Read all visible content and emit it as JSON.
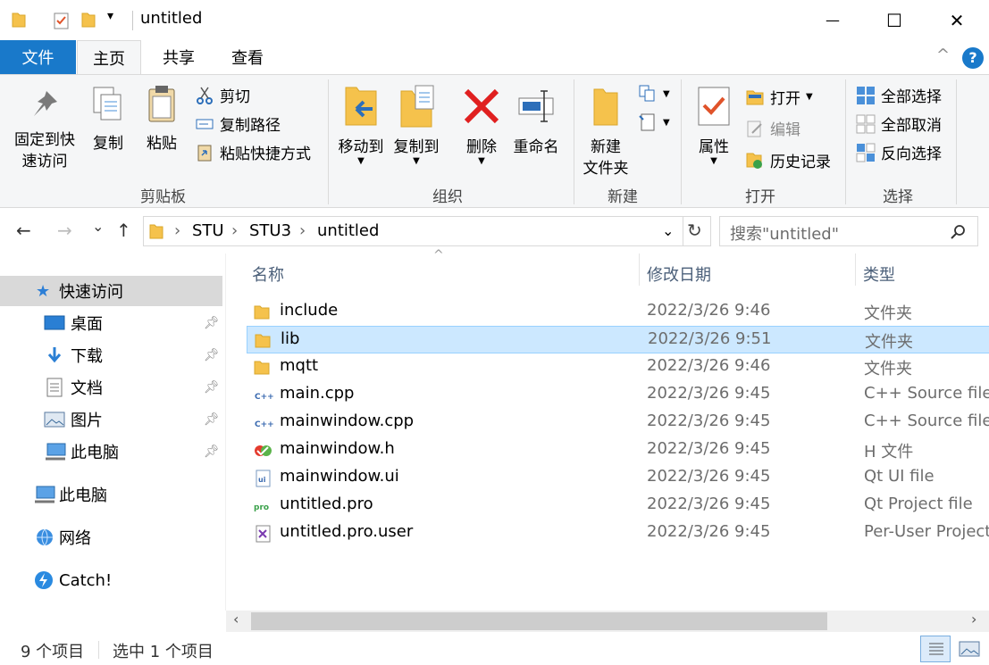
{
  "window": {
    "title": "untitled",
    "qa_dropdown": "▾",
    "minimize": "—",
    "maximize": "☐",
    "close": "✕"
  },
  "tabs": {
    "file": "文件",
    "home": "主页",
    "share": "共享",
    "view": "查看",
    "help": "?",
    "collapse": "^"
  },
  "ribbon": {
    "clipboard": {
      "label": "剪贴板",
      "pin_line1": "固定到快",
      "pin_line2": "速访问",
      "copy": "复制",
      "paste": "粘贴",
      "cut": "剪切",
      "copy_path": "复制路径",
      "paste_shortcut": "粘贴快捷方式"
    },
    "organize": {
      "label": "组织",
      "move_to": "移动到",
      "copy_to": "复制到",
      "delete": "删除",
      "rename": "重命名"
    },
    "new": {
      "label": "新建",
      "new_folder_line1": "新建",
      "new_folder_line2": "文件夹"
    },
    "open": {
      "label": "打开",
      "properties": "属性",
      "open": "打开",
      "edit": "编辑",
      "history": "历史记录"
    },
    "select": {
      "label": "选择",
      "select_all": "全部选择",
      "select_none": "全部取消",
      "invert": "反向选择"
    }
  },
  "nav": {
    "back": "←",
    "forward": "→",
    "recent": "⌄",
    "up": "↑",
    "breadcrumbs": [
      "STU",
      "STU3",
      "untitled"
    ],
    "sep": "›",
    "search_placeholder": "搜索\"untitled\""
  },
  "sidebar": {
    "quick_access": "快速访问",
    "items": [
      {
        "label": "桌面",
        "icon": "desktop-icon"
      },
      {
        "label": "下载",
        "icon": "download-icon"
      },
      {
        "label": "文档",
        "icon": "document-icon"
      },
      {
        "label": "图片",
        "icon": "picture-icon"
      },
      {
        "label": "此电脑",
        "icon": "computer-icon"
      }
    ],
    "this_pc": "此电脑",
    "network": "网络",
    "catch": "Catch!"
  },
  "columns": {
    "name": "名称",
    "date": "修改日期",
    "type": "类型"
  },
  "files": [
    {
      "name": "include",
      "date": "2022/3/26 9:46",
      "type": "文件夹",
      "icon": "folder-icon"
    },
    {
      "name": "lib",
      "date": "2022/3/26 9:51",
      "type": "文件夹",
      "icon": "folder-icon",
      "selected": true
    },
    {
      "name": "mqtt",
      "date": "2022/3/26 9:46",
      "type": "文件夹",
      "icon": "folder-icon"
    },
    {
      "name": "main.cpp",
      "date": "2022/3/26 9:45",
      "type": "C++ Source file",
      "icon": "cpp-file-icon"
    },
    {
      "name": "mainwindow.cpp",
      "date": "2022/3/26 9:45",
      "type": "C++ Source file",
      "icon": "cpp-file-icon"
    },
    {
      "name": "mainwindow.h",
      "date": "2022/3/26 9:45",
      "type": "H 文件",
      "icon": "header-file-icon"
    },
    {
      "name": "mainwindow.ui",
      "date": "2022/3/26 9:45",
      "type": "Qt UI file",
      "icon": "ui-file-icon"
    },
    {
      "name": "untitled.pro",
      "date": "2022/3/26 9:45",
      "type": "Qt Project file",
      "icon": "pro-file-icon"
    },
    {
      "name": "untitled.pro.user",
      "date": "2022/3/26 9:45",
      "type": "Per-User Project",
      "icon": "vs-file-icon"
    }
  ],
  "status": {
    "count": "9 个项目",
    "selected": "选中 1 个项目"
  },
  "colors": {
    "accent": "#1979ca",
    "selection": "#cce8ff",
    "folder": "#f5c24c"
  }
}
